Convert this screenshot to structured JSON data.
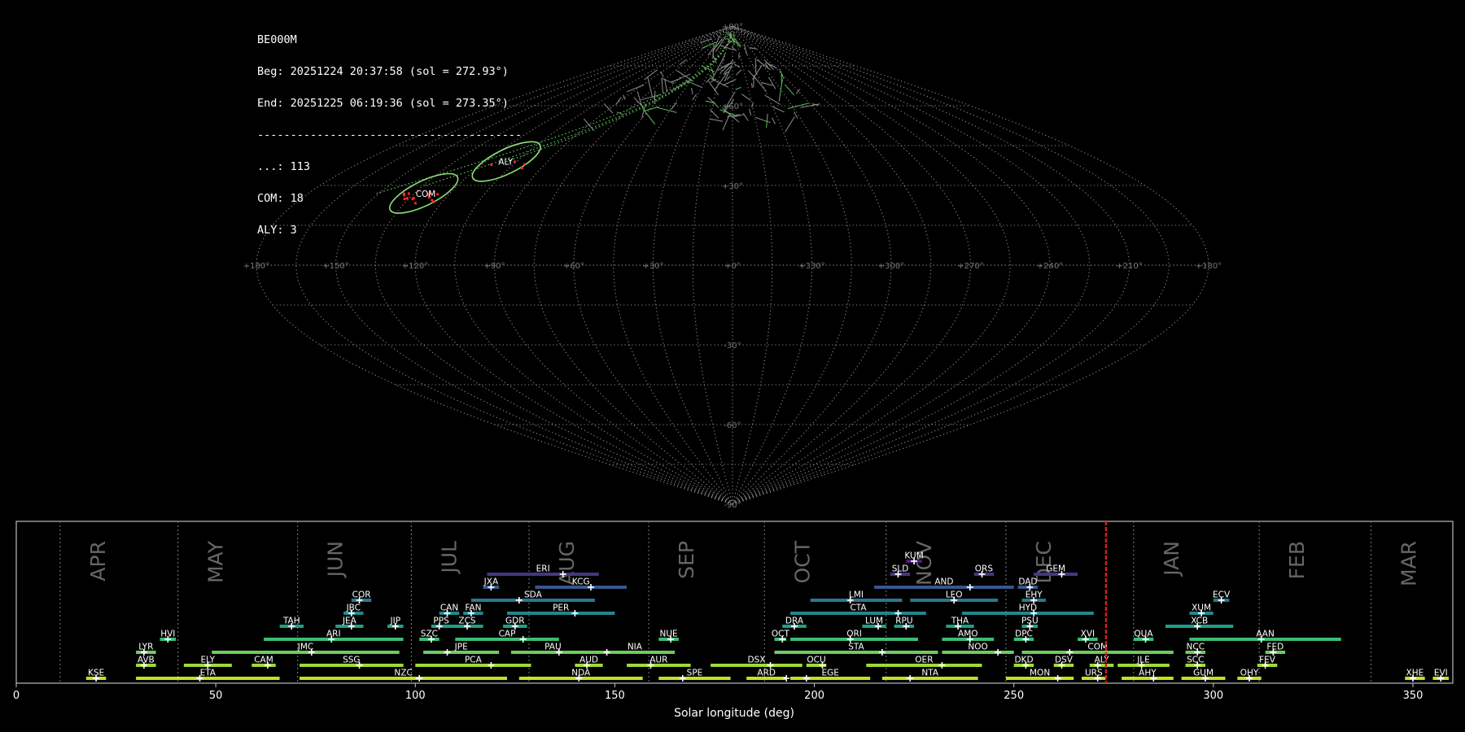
{
  "info": {
    "camera": "BE000M",
    "begin": "Beg: 20251224 20:37:58 (sol = 272.93°)",
    "end": "End: 20251225 06:19:36 (sol = 273.35°)",
    "separator": "----------------------------------------",
    "counts": [
      "...: 113",
      "COM: 18",
      "ALY: 3"
    ]
  },
  "sky": {
    "lon_ticks": [
      "+180°",
      "+150°",
      "+120°",
      "+90°",
      "+60°",
      "+30°",
      "+0°",
      "+330°",
      "+300°",
      "+270°",
      "+240°",
      "+210°",
      "+180°"
    ],
    "lat_ticks": [
      "+90°",
      "+60°",
      "+30°",
      "-30°",
      "-60°",
      "-90°"
    ],
    "showers": [
      {
        "code": "COM",
        "lon": 131,
        "lat": 27
      },
      {
        "code": "ALY",
        "lon": 110,
        "lat": 39
      }
    ]
  },
  "chart_data": {
    "type": "timeline",
    "xlabel": "Solar longitude (deg)",
    "xlim": [
      0,
      360
    ],
    "xticks": [
      0,
      50,
      100,
      150,
      200,
      250,
      300,
      350
    ],
    "months": [
      {
        "name": "APR",
        "start": 11
      },
      {
        "name": "MAY",
        "start": 40.5
      },
      {
        "name": "JUN",
        "start": 70.5
      },
      {
        "name": "JUL",
        "start": 99
      },
      {
        "name": "AUG",
        "start": 128.5
      },
      {
        "name": "SEP",
        "start": 158.5
      },
      {
        "name": "OCT",
        "start": 187.5
      },
      {
        "name": "NOV",
        "start": 218
      },
      {
        "name": "DEC",
        "start": 248
      },
      {
        "name": "JAN",
        "start": 280
      },
      {
        "name": "FEB",
        "start": 311.5
      },
      {
        "name": "MAR",
        "start": 339.5
      }
    ],
    "current_sol": 273.1,
    "showers": [
      {
        "code": "KSE",
        "start": 17.5,
        "end": 22.5,
        "peak": 20,
        "row": 0
      },
      {
        "code": "ETA",
        "start": 30,
        "end": 66,
        "peak": 46,
        "row": 0
      },
      {
        "code": "NZC",
        "start": 71,
        "end": 123,
        "peak": 101,
        "row": 0
      },
      {
        "code": "NDA",
        "start": 126,
        "end": 157,
        "peak": 141,
        "row": 0
      },
      {
        "code": "SPE",
        "start": 161,
        "end": 179,
        "peak": 167,
        "row": 0
      },
      {
        "code": "ARD",
        "start": 183,
        "end": 193,
        "peak": 193,
        "row": 0
      },
      {
        "code": "EGE",
        "start": 194,
        "end": 214,
        "peak": 198,
        "row": 0
      },
      {
        "code": "NTA",
        "start": 217,
        "end": 241,
        "peak": 224,
        "row": 0
      },
      {
        "code": "MON",
        "start": 248,
        "end": 265,
        "peak": 261,
        "row": 0
      },
      {
        "code": "URS",
        "start": 267,
        "end": 273,
        "peak": 271,
        "row": 0
      },
      {
        "code": "AHY",
        "start": 277,
        "end": 290,
        "peak": 285,
        "row": 0
      },
      {
        "code": "GUM",
        "start": 292,
        "end": 303,
        "peak": 298,
        "row": 0
      },
      {
        "code": "OHY",
        "start": 306,
        "end": 312,
        "peak": 309,
        "row": 0
      },
      {
        "code": "XHE",
        "start": 348,
        "end": 353,
        "peak": 350,
        "row": 0
      },
      {
        "code": "EVI",
        "start": 355,
        "end": 359,
        "peak": 357,
        "row": 0
      },
      {
        "code": "AVB",
        "start": 30,
        "end": 35,
        "peak": 32,
        "row": 1
      },
      {
        "code": "ELY",
        "start": 42,
        "end": 54,
        "peak": 48,
        "row": 1
      },
      {
        "code": "CAM",
        "start": 59,
        "end": 65,
        "peak": 63,
        "row": 1
      },
      {
        "code": "SSG",
        "start": 71,
        "end": 97,
        "peak": 86,
        "row": 1
      },
      {
        "code": "PCA",
        "start": 100,
        "end": 129,
        "peak": 119,
        "row": 1
      },
      {
        "code": "AUD",
        "start": 140,
        "end": 147,
        "peak": 143,
        "row": 1
      },
      {
        "code": "AUR",
        "start": 153,
        "end": 169,
        "peak": 159,
        "row": 1
      },
      {
        "code": "DSX",
        "start": 174,
        "end": 197,
        "peak": 189,
        "row": 1
      },
      {
        "code": "OCU",
        "start": 198,
        "end": 203,
        "peak": 202,
        "row": 1
      },
      {
        "code": "OER",
        "start": 213,
        "end": 242,
        "peak": 232,
        "row": 1
      },
      {
        "code": "DKD",
        "start": 250,
        "end": 255,
        "peak": 253,
        "row": 1
      },
      {
        "code": "DSV",
        "start": 260,
        "end": 265,
        "peak": 262,
        "row": 1
      },
      {
        "code": "ALY",
        "start": 269,
        "end": 275,
        "peak": 271,
        "row": 1
      },
      {
        "code": "JLE",
        "start": 276,
        "end": 289,
        "peak": 282,
        "row": 1
      },
      {
        "code": "SCC",
        "start": 293,
        "end": 298,
        "peak": 296,
        "row": 1
      },
      {
        "code": "FEV",
        "start": 311,
        "end": 316,
        "peak": 313,
        "row": 1
      },
      {
        "code": "LYR",
        "start": 30,
        "end": 35,
        "peak": 32,
        "row": 2
      },
      {
        "code": "JMC",
        "start": 49,
        "end": 96,
        "peak": 74,
        "row": 2
      },
      {
        "code": "JPE",
        "start": 102,
        "end": 121,
        "peak": 108,
        "row": 2
      },
      {
        "code": "PAU",
        "start": 124,
        "end": 145,
        "peak": 136,
        "row": 2
      },
      {
        "code": "NIA",
        "start": 145,
        "end": 165,
        "peak": 148,
        "row": 2
      },
      {
        "code": "STA",
        "start": 190,
        "end": 231,
        "peak": 217,
        "row": 2
      },
      {
        "code": "NOO",
        "start": 232,
        "end": 250,
        "peak": 246,
        "row": 2
      },
      {
        "code": "COM",
        "start": 252,
        "end": 290,
        "peak": 264,
        "row": 2
      },
      {
        "code": "NCC",
        "start": 293,
        "end": 298,
        "peak": 296,
        "row": 2
      },
      {
        "code": "FED",
        "start": 313,
        "end": 318,
        "peak": 315,
        "row": 2
      },
      {
        "code": "HVI",
        "start": 36,
        "end": 40,
        "peak": 38,
        "row": 3
      },
      {
        "code": "ARI",
        "start": 62,
        "end": 97,
        "peak": 79,
        "row": 3
      },
      {
        "code": "SZC",
        "start": 101,
        "end": 106,
        "peak": 104,
        "row": 3
      },
      {
        "code": "CAP",
        "start": 110,
        "end": 136,
        "peak": 127,
        "row": 3
      },
      {
        "code": "NUE",
        "start": 161,
        "end": 166,
        "peak": 164,
        "row": 3
      },
      {
        "code": "OCT",
        "start": 190,
        "end": 193,
        "peak": 192,
        "row": 3
      },
      {
        "code": "ORI",
        "start": 194,
        "end": 226,
        "peak": 209,
        "row": 3
      },
      {
        "code": "AMO",
        "start": 232,
        "end": 245,
        "peak": 239,
        "row": 3
      },
      {
        "code": "DPC",
        "start": 250,
        "end": 255,
        "peak": 253,
        "row": 3
      },
      {
        "code": "XVI",
        "start": 266,
        "end": 271,
        "peak": 268,
        "row": 3
      },
      {
        "code": "QUA",
        "start": 280,
        "end": 285,
        "peak": 283,
        "row": 3
      },
      {
        "code": "AAN",
        "start": 294,
        "end": 332,
        "peak": 312,
        "row": 3
      },
      {
        "code": "TAH",
        "start": 66,
        "end": 72,
        "peak": 69,
        "row": 4
      },
      {
        "code": "JEA",
        "start": 80,
        "end": 87,
        "peak": 84,
        "row": 4
      },
      {
        "code": "JIP",
        "start": 93,
        "end": 97,
        "peak": 95,
        "row": 4
      },
      {
        "code": "PPS",
        "start": 104,
        "end": 109,
        "peak": 106,
        "row": 4
      },
      {
        "code": "ZCS",
        "start": 109,
        "end": 117,
        "peak": 113,
        "row": 4
      },
      {
        "code": "GDR",
        "start": 122,
        "end": 128,
        "peak": 125,
        "row": 4
      },
      {
        "code": "DRA",
        "start": 192,
        "end": 198,
        "peak": 195,
        "row": 4
      },
      {
        "code": "LUM",
        "start": 212,
        "end": 218,
        "peak": 216,
        "row": 4
      },
      {
        "code": "RPU",
        "start": 220,
        "end": 225,
        "peak": 223,
        "row": 4
      },
      {
        "code": "THA",
        "start": 233,
        "end": 240,
        "peak": 236,
        "row": 4
      },
      {
        "code": "PSU",
        "start": 252,
        "end": 256,
        "peak": 254,
        "row": 4
      },
      {
        "code": "XCB",
        "start": 288,
        "end": 305,
        "peak": 296,
        "row": 4
      },
      {
        "code": "JBC",
        "start": 82,
        "end": 87,
        "peak": 84,
        "row": 5
      },
      {
        "code": "CAN",
        "start": 106,
        "end": 111,
        "peak": 108,
        "row": 5
      },
      {
        "code": "FAN",
        "start": 112,
        "end": 117,
        "peak": 114,
        "row": 5
      },
      {
        "code": "PER",
        "start": 123,
        "end": 150,
        "peak": 140,
        "row": 5
      },
      {
        "code": "CTA",
        "start": 194,
        "end": 228,
        "peak": 221,
        "row": 5
      },
      {
        "code": "HYD",
        "start": 237,
        "end": 270,
        "peak": 255,
        "row": 5
      },
      {
        "code": "XUM",
        "start": 294,
        "end": 300,
        "peak": 297,
        "row": 5
      },
      {
        "code": "COR",
        "start": 84,
        "end": 89,
        "peak": 86,
        "row": 6
      },
      {
        "code": "SDA",
        "start": 114,
        "end": 145,
        "peak": 126,
        "row": 6
      },
      {
        "code": "LMI",
        "start": 199,
        "end": 222,
        "peak": 209,
        "row": 6
      },
      {
        "code": "LEO",
        "start": 224,
        "end": 246,
        "peak": 235,
        "row": 6
      },
      {
        "code": "EHY",
        "start": 252,
        "end": 258,
        "peak": 255,
        "row": 6
      },
      {
        "code": "ECV",
        "start": 300,
        "end": 304,
        "peak": 302,
        "row": 6
      },
      {
        "code": "JXA",
        "start": 117,
        "end": 121,
        "peak": 119,
        "row": 7
      },
      {
        "code": "KCG",
        "start": 130,
        "end": 153,
        "peak": 144,
        "row": 7
      },
      {
        "code": "AND",
        "start": 215,
        "end": 250,
        "peak": 239,
        "row": 7
      },
      {
        "code": "DAD",
        "start": 251,
        "end": 256,
        "peak": 254,
        "row": 7
      },
      {
        "code": "ERI",
        "start": 118,
        "end": 146,
        "peak": 137,
        "row": 8
      },
      {
        "code": "SLD",
        "start": 219,
        "end": 224,
        "peak": 221,
        "row": 8
      },
      {
        "code": "ORS",
        "start": 240,
        "end": 245,
        "peak": 242,
        "row": 8
      },
      {
        "code": "GEM",
        "start": 255,
        "end": 266,
        "peak": 262,
        "row": 8
      },
      {
        "code": "KUM",
        "start": 223,
        "end": 227,
        "peak": 225,
        "row": 9
      }
    ]
  }
}
